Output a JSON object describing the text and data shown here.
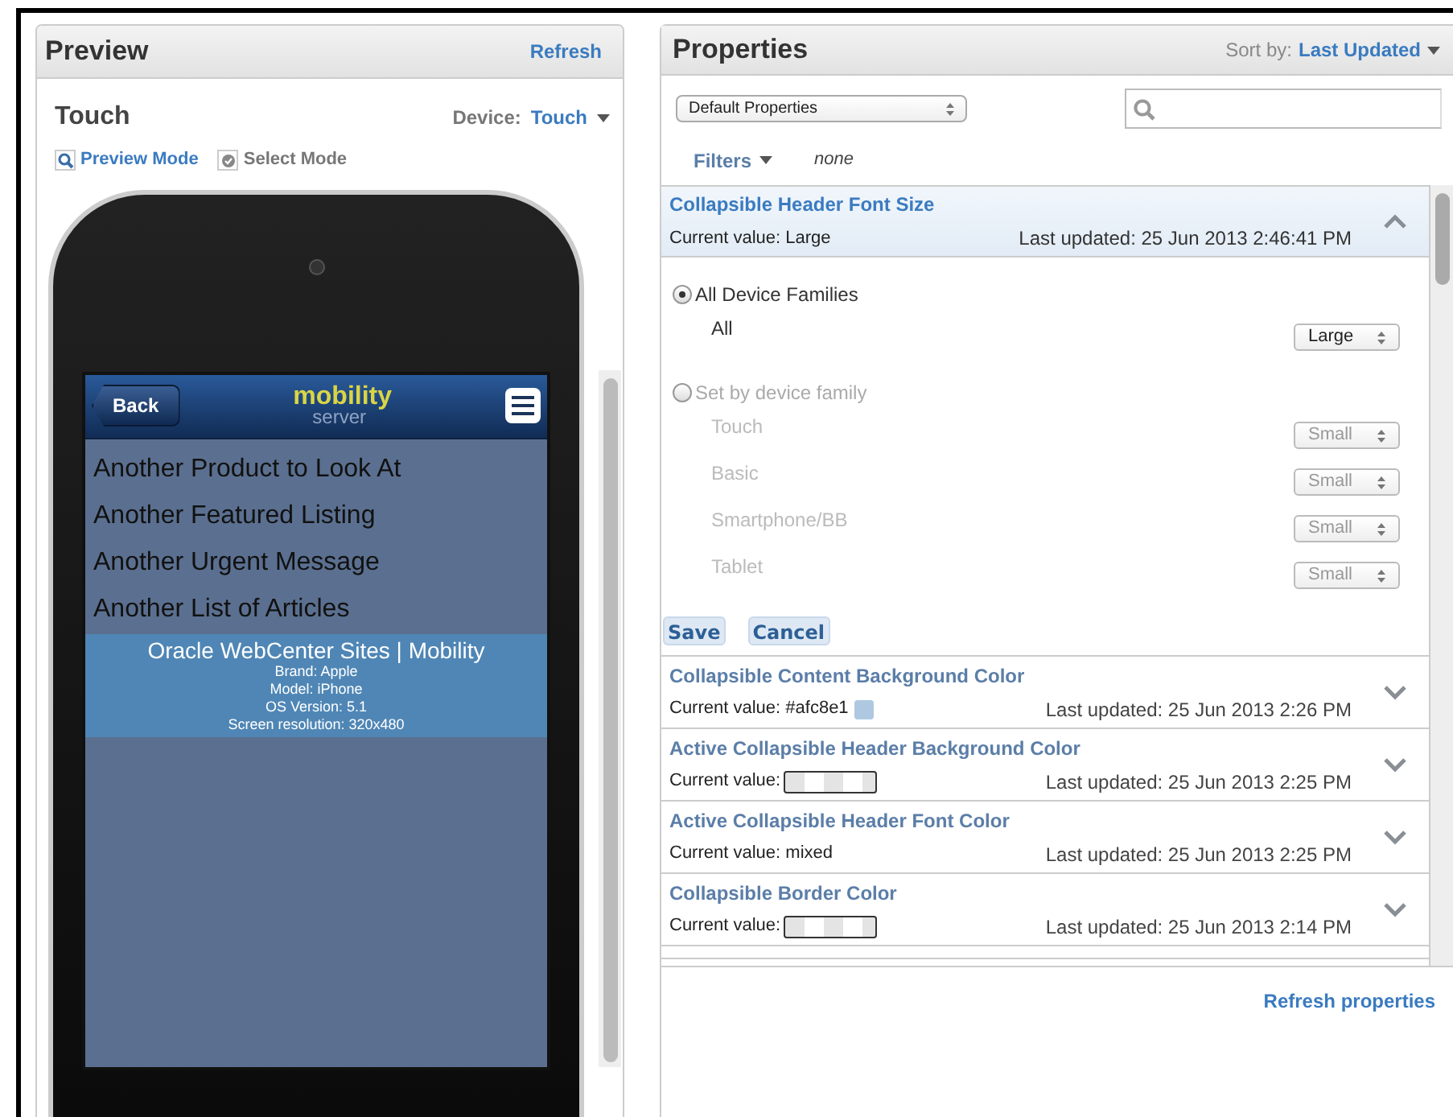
{
  "preview": {
    "title": "Preview",
    "refresh": "Refresh",
    "device_name": "Touch",
    "device_label": "Device:",
    "device_value": "Touch",
    "modes": [
      {
        "label": "Preview Mode",
        "selected": true
      },
      {
        "label": "Select Mode",
        "selected": false
      }
    ],
    "phone": {
      "back": "Back",
      "logo": "mobility",
      "logo_sub": "server",
      "items": [
        "Another Product to Look At",
        "Another Featured Listing",
        "Another Urgent Message",
        "Another List of Articles"
      ],
      "footer_title": "Oracle WebCenter Sites | Mobility",
      "footer_lines": [
        "Brand: Apple",
        "Model: iPhone",
        "OS Version: 5.1",
        "Screen resolution: 320x480"
      ]
    }
  },
  "properties": {
    "title": "Properties",
    "sort_label": "Sort by:",
    "sort_value": "Last Updated",
    "set_select": "Default Properties",
    "filters": "Filters",
    "filters_value": "none",
    "items": [
      {
        "kind": "expanded",
        "name": "Collapsible Header Font Size",
        "value_label": "Current value:",
        "current": {
          "kind": "text",
          "value": "Large"
        },
        "updated": "Last updated: 25 Jun 2013 2:46:41 PM",
        "options": [
          {
            "label": "All Device Families",
            "selected": true,
            "rows": [
              {
                "label": "All",
                "value": "Large"
              }
            ]
          },
          {
            "label": "Set by device family",
            "selected": false,
            "rows": [
              {
                "label": "Touch",
                "value": "Small"
              },
              {
                "label": "Basic",
                "value": "Small"
              },
              {
                "label": "Smartphone/BB",
                "value": "Small"
              },
              {
                "label": "Tablet",
                "value": "Small"
              }
            ]
          }
        ],
        "buttons": [
          "Save",
          "Cancel"
        ]
      },
      {
        "kind": "collapsed",
        "name": "Collapsible Content Background Color",
        "value_label": "Current value:",
        "current": {
          "kind": "color",
          "value": "#afc8e1",
          "color": "#afc8e1"
        },
        "updated": "Last updated: 25 Jun 2013 2:26 PM"
      },
      {
        "kind": "collapsed",
        "name": "Active Collapsible Header Background Color",
        "value_label": "Current value:",
        "current": {
          "kind": "transparent"
        },
        "updated": "Last updated: 25 Jun 2013 2:25 PM"
      },
      {
        "kind": "collapsed",
        "name": "Active Collapsible Header Font Color",
        "value_label": "Current value:",
        "current": {
          "kind": "text",
          "value": "mixed"
        },
        "updated": "Last updated: 25 Jun 2013 2:25 PM"
      },
      {
        "kind": "collapsed",
        "name": "Collapsible Border Color",
        "value_label": "Current value:",
        "current": {
          "kind": "transparent"
        },
        "updated": "Last updated: 25 Jun 2013 2:14 PM"
      },
      {
        "kind": "cut"
      }
    ],
    "refresh": "Refresh properties"
  }
}
